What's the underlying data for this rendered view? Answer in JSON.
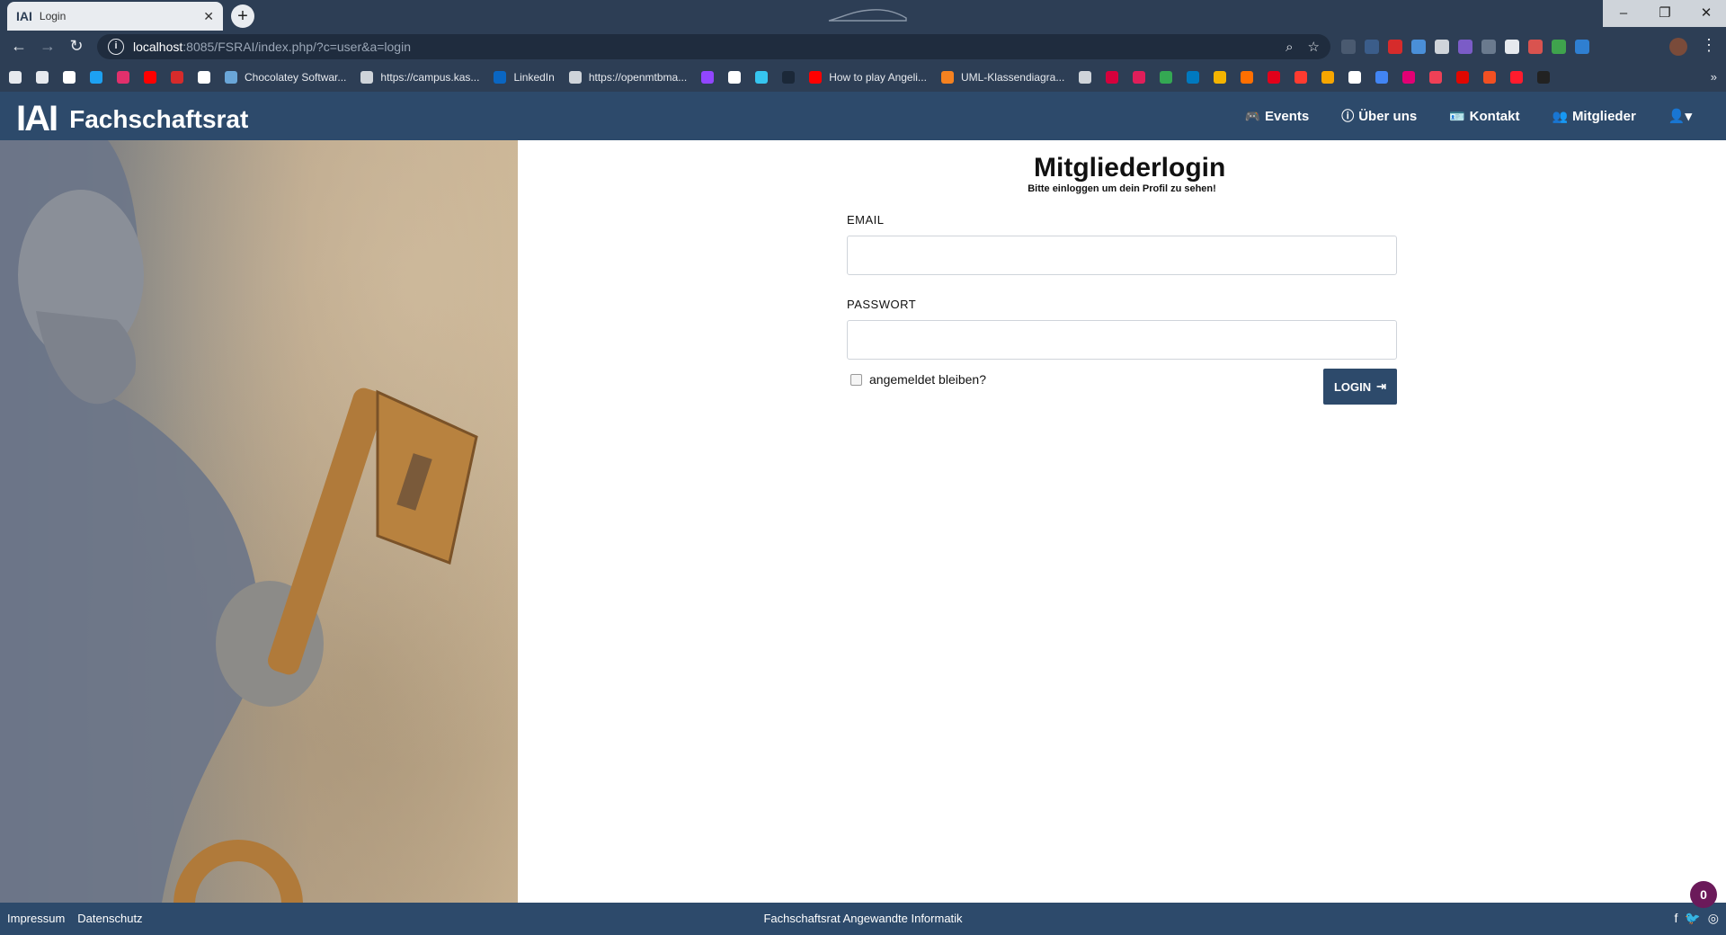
{
  "browser": {
    "tab_title": "Login",
    "tab_favicon": "IAI",
    "url_host": "localhost",
    "url_path": ":8085/FSRAI/index.php/?c=user&a=login",
    "bookmarks": [
      {
        "label": "",
        "icon": "history-icon",
        "color": "#e6e9ee"
      },
      {
        "label": "",
        "icon": "download-icon",
        "color": "#e6e9ee"
      },
      {
        "label": "",
        "icon": "google-icon",
        "color": "#ffffff"
      },
      {
        "label": "",
        "icon": "twitter-icon",
        "color": "#1da1f2"
      },
      {
        "label": "",
        "icon": "instagram-icon",
        "color": "#e1306c"
      },
      {
        "label": "",
        "icon": "youtube-icon",
        "color": "#ff0000"
      },
      {
        "label": "",
        "icon": "bookmark-red-icon",
        "color": "#d62b2b"
      },
      {
        "label": "",
        "icon": "amazon-icon",
        "color": "#ffffff"
      },
      {
        "label": "Chocolatey Softwar...",
        "icon": "chocolatey-icon",
        "color": "#6aa6d8"
      },
      {
        "label": "https://campus.kas...",
        "icon": "globe-icon",
        "color": "#cfd4da"
      },
      {
        "label": "LinkedIn",
        "icon": "linkedin-icon",
        "color": "#0a66c2"
      },
      {
        "label": "https://openmtbma...",
        "icon": "globe-icon",
        "color": "#cfd4da"
      },
      {
        "label": "",
        "icon": "twitch-icon",
        "color": "#9146ff"
      },
      {
        "label": "",
        "icon": "github-icon",
        "color": "#ffffff"
      },
      {
        "label": "",
        "icon": "slack-icon",
        "color": "#36c5f0"
      },
      {
        "label": "",
        "icon": "app-icon",
        "color": "#1b2838"
      },
      {
        "label": "How to play Angeli...",
        "icon": "youtube-icon",
        "color": "#ff0000"
      },
      {
        "label": "UML-Klassendiagra...",
        "icon": "orange-doc-icon",
        "color": "#f58220"
      },
      {
        "label": "",
        "icon": "globe-icon",
        "color": "#cfd4da"
      },
      {
        "label": "",
        "icon": "kicker-icon",
        "color": "#d6003c"
      },
      {
        "label": "",
        "icon": "m-icon",
        "color": "#e01e5a"
      },
      {
        "label": "",
        "icon": "drive-icon",
        "color": "#34a853"
      },
      {
        "label": "",
        "icon": "trello-icon",
        "color": "#0079bf"
      },
      {
        "label": "",
        "icon": "pinwheel-icon",
        "color": "#f4b400"
      },
      {
        "label": "",
        "icon": "orange-app-icon",
        "color": "#ff6f00"
      },
      {
        "label": "",
        "icon": "sparkasse-icon",
        "color": "#e2001a"
      },
      {
        "label": "",
        "icon": "red-check-icon",
        "color": "#ff3b30"
      },
      {
        "label": "",
        "icon": "d-icon",
        "color": "#f7a600"
      },
      {
        "label": "",
        "icon": "lt-icon",
        "color": "#ffffff"
      },
      {
        "label": "",
        "icon": "translate-icon",
        "color": "#4285f4"
      },
      {
        "label": "",
        "icon": "telekom-icon",
        "color": "#e20074"
      },
      {
        "label": "",
        "icon": "pocket-icon",
        "color": "#ef4056"
      },
      {
        "label": "",
        "icon": "news-icon",
        "color": "#e10600"
      },
      {
        "label": "",
        "icon": "microsoft-icon",
        "color": "#f25022"
      },
      {
        "label": "",
        "icon": "opera-icon",
        "color": "#ff1b2d"
      },
      {
        "label": "",
        "icon": "dark-circle-icon",
        "color": "#222222"
      }
    ],
    "more_glyph": "»"
  },
  "site": {
    "brand_mark": "IAI",
    "brand_name": "Fachschaftsrat",
    "nav": [
      {
        "label": "Events",
        "icon": "gamepad-icon",
        "glyph": "🎮"
      },
      {
        "label": "Über uns",
        "icon": "info-icon",
        "glyph": "ⓘ"
      },
      {
        "label": "Kontakt",
        "icon": "id-card-icon",
        "glyph": "🪪"
      },
      {
        "label": "Mitglieder",
        "icon": "users-icon",
        "glyph": "👥"
      }
    ],
    "user_menu_glyph": "👤▾"
  },
  "login": {
    "title": "Mitgliederlogin",
    "subtitle": "Bitte einloggen um dein Profil zu sehen!",
    "email_label": "EMAIL",
    "email_value": "",
    "password_label": "PASSWORT",
    "password_value": "",
    "remember_label": "angemeldet bleiben?",
    "button_label": "LOGIN",
    "button_glyph": "⇥"
  },
  "footer": {
    "impressum": "Impressum",
    "datenschutz": "Datenschutz",
    "center_text": "Fachschaftsrat Angewandte Informatik",
    "social": [
      {
        "icon": "facebook-icon",
        "glyph": "f"
      },
      {
        "icon": "twitter-icon",
        "glyph": "🐦"
      },
      {
        "icon": "instagram-icon",
        "glyph": "◎"
      }
    ]
  },
  "notification_badge": "0",
  "colors": {
    "chrome": "#2d3e55",
    "site_header": "#2d4a6b",
    "badge": "#6b1a5a"
  }
}
